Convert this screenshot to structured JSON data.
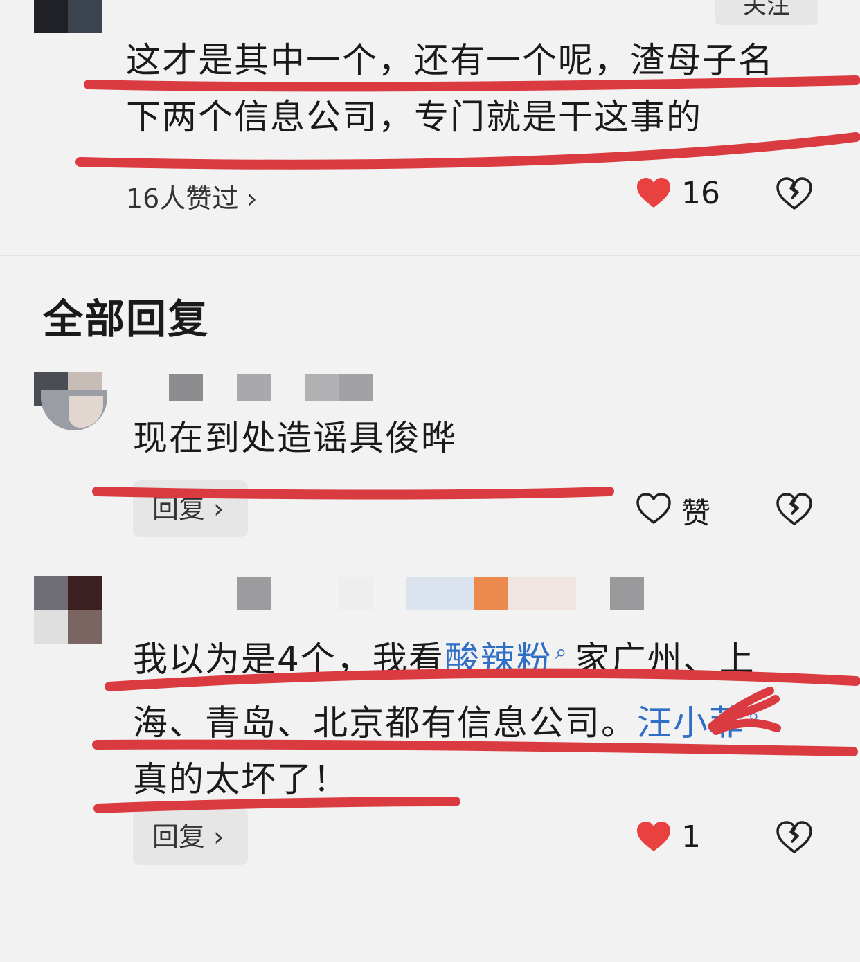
{
  "top_comment": {
    "follow_label": "关注",
    "text_line1": "这才是其中一个，还有一个呢，渣母子名",
    "text_line2": "下两个信息公司，专门就是干这事的",
    "likers_label": "16人赞过 ›",
    "like_count": "16"
  },
  "section": {
    "title": "全部回复"
  },
  "replies": [
    {
      "text": "现在到处造谣具俊晔",
      "reply_label": "回复 ›",
      "like_label": "赞"
    },
    {
      "line1_a": "我以为是4个，我看",
      "line1_link": "酸辣粉",
      "line1_b": "家广州、上",
      "line2_a": "海、青岛、北京都有信息公司。",
      "line2_link": "汪小菲",
      "line3": "真的太坏了！",
      "reply_label": "回复 ›",
      "like_count": "1"
    }
  ],
  "colors": {
    "accent_red": "#e8413f",
    "link_blue": "#2f6fc6",
    "annotation_red": "#d93b40"
  },
  "icons": {
    "heart_filled": "heart-filled-icon",
    "heart_outline": "heart-outline-icon",
    "broken_heart": "broken-heart-icon",
    "search": "search-icon"
  }
}
